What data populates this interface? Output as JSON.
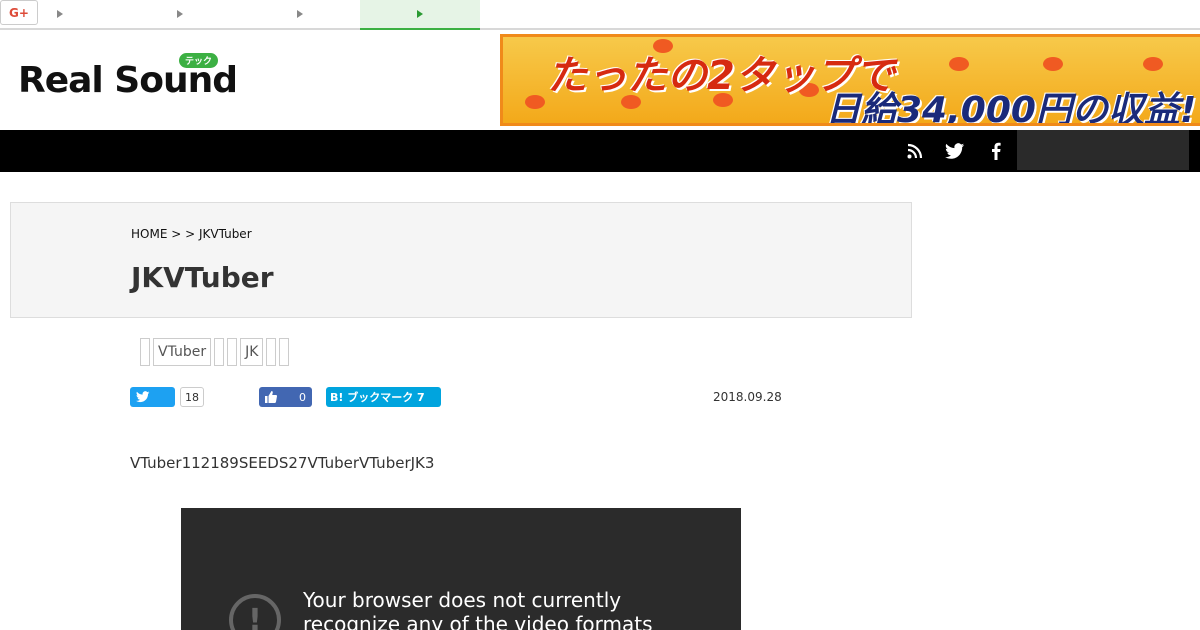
{
  "topnav": {
    "tabs": [
      "",
      "",
      "",
      ""
    ],
    "active_index": 3
  },
  "logo": {
    "text": "Real Sound",
    "badge": "テック"
  },
  "banner": {
    "line1": "たったの2タップで",
    "line2": "日給34,000円の収益!"
  },
  "header": {
    "icons": [
      "rss-icon",
      "twitter-icon",
      "facebook-icon"
    ]
  },
  "breadcrumb": "HOME >   > JKVTuber",
  "title": "JKVTuber",
  "tags": [
    "",
    "VTuber",
    "",
    "",
    "JK",
    "",
    ""
  ],
  "share": {
    "twitter_count": "18",
    "facebook_count": "0",
    "hatena_label": "B! ブックマーク 7",
    "gplus_label": "G+"
  },
  "date": "2018.09.28",
  "body_text": "VTuber112189SEEDS27VTuberVTuberJK3",
  "video": {
    "message": "Your browser does not currently recognize any of the video formats"
  },
  "colors": {
    "accent_green": "#3cb043",
    "twitter": "#1da1f2",
    "facebook": "#4267b2",
    "hatena": "#00a4de",
    "gplus": "#dd4b39"
  }
}
